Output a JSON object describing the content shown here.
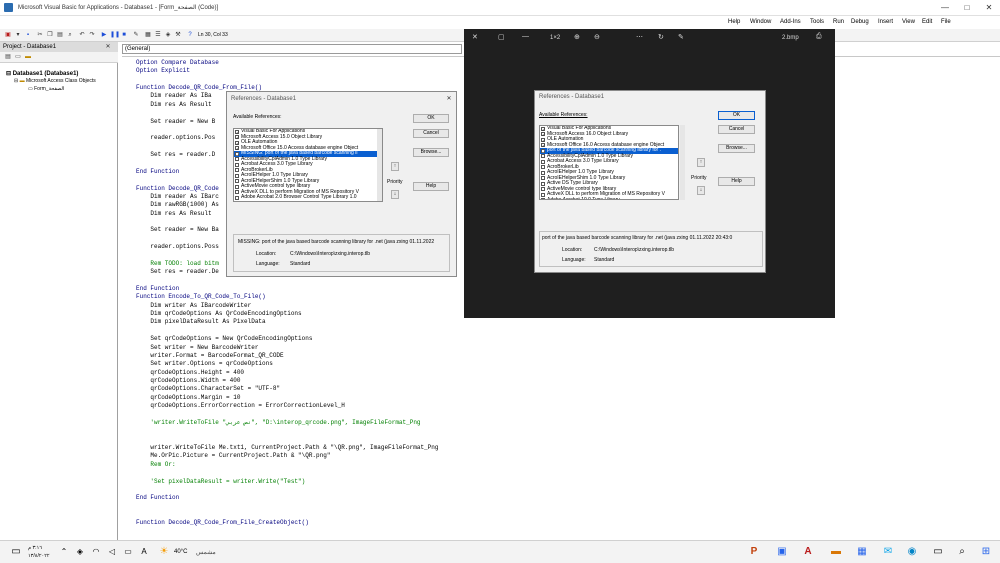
{
  "titlebar": {
    "title": "Microsoft Visual Basic for Applications - Database1 - [Form_الصفحة (Code)]",
    "min": "—",
    "max": "□",
    "close": "✕"
  },
  "menus": [
    "Help",
    "Window",
    "Add-Ins",
    "Tools",
    "Run",
    "Debug",
    "Insert",
    "View",
    "Edit",
    "File"
  ],
  "toolbar": {
    "position": "Ln 30, Col 33"
  },
  "project": {
    "header": "Project - Database1",
    "root": "Database1 (Database1)",
    "folder": "Microsoft Access Class Objects",
    "item": "Form_الصفحة"
  },
  "combo": "(General)",
  "code_lines": [
    {
      "t": "Option Compare Database",
      "c": "kw"
    },
    {
      "t": "Option Explicit",
      "c": "kw"
    },
    {
      "t": "",
      "c": ""
    },
    {
      "t": "Function Decode_QR_Code_From_File()",
      "c": "kw"
    },
    {
      "t": "    Dim reader As IBa",
      "c": ""
    },
    {
      "t": "    Dim res As Result",
      "c": ""
    },
    {
      "t": "",
      "c": ""
    },
    {
      "t": "    Set reader = New B",
      "c": ""
    },
    {
      "t": "",
      "c": ""
    },
    {
      "t": "    reader.options.Pos",
      "c": ""
    },
    {
      "t": "",
      "c": ""
    },
    {
      "t": "    Set res = reader.D",
      "c": ""
    },
    {
      "t": "",
      "c": ""
    },
    {
      "t": "End Function",
      "c": "kw"
    },
    {
      "t": "",
      "c": ""
    },
    {
      "t": "Function Decode_QR_Code",
      "c": "kw"
    },
    {
      "t": "    Dim reader As IBarc",
      "c": ""
    },
    {
      "t": "    Dim rawRGB(1000) As",
      "c": ""
    },
    {
      "t": "    Dim res As Result",
      "c": ""
    },
    {
      "t": "",
      "c": ""
    },
    {
      "t": "    Set reader = New Ba",
      "c": ""
    },
    {
      "t": "",
      "c": ""
    },
    {
      "t": "    reader.options.Poss",
      "c": ""
    },
    {
      "t": "",
      "c": ""
    },
    {
      "t": "    Rem TODO: load bitm",
      "c": "cm"
    },
    {
      "t": "    Set res = reader.De",
      "c": ""
    },
    {
      "t": "",
      "c": ""
    },
    {
      "t": "End Function",
      "c": "kw"
    },
    {
      "t": "Function Encode_To_QR_Code_To_File()",
      "c": "kw"
    },
    {
      "t": "    Dim writer As IBarcodeWriter",
      "c": ""
    },
    {
      "t": "    Dim qrCodeOptions As QrCodeEncodingOptions",
      "c": ""
    },
    {
      "t": "    Dim pixelDataResult As PixelData",
      "c": ""
    },
    {
      "t": "",
      "c": ""
    },
    {
      "t": "    Set qrCodeOptions = New QrCodeEncodingOptions",
      "c": ""
    },
    {
      "t": "    Set writer = New BarcodeWriter",
      "c": ""
    },
    {
      "t": "    writer.Format = BarcodeFormat_QR_CODE",
      "c": ""
    },
    {
      "t": "    Set writer.Options = qrCodeOptions",
      "c": ""
    },
    {
      "t": "    qrCodeOptions.Height = 400",
      "c": ""
    },
    {
      "t": "    qrCodeOptions.Width = 400",
      "c": ""
    },
    {
      "t": "    qrCodeOptions.CharacterSet = \"UTF-8\"",
      "c": ""
    },
    {
      "t": "    qrCodeOptions.Margin = 10",
      "c": ""
    },
    {
      "t": "    qrCodeOptions.ErrorCorrection = ErrorCorrectionLevel_H",
      "c": ""
    },
    {
      "t": "",
      "c": ""
    },
    {
      "t": "    'writer.WriteToFile \"نص عربي\", \"D:\\interop_qrcode.png\", ImageFileFormat_Png",
      "c": "cm"
    },
    {
      "t": "",
      "c": ""
    },
    {
      "t": "",
      "c": ""
    },
    {
      "t": "    writer.WriteToFile Me.txt1, CurrentProject.Path & \"\\QR.png\", ImageFileFormat_Png",
      "c": ""
    },
    {
      "t": "    Me.OrPic.Picture = CurrentProject.Path & \"\\QR.png\"",
      "c": ""
    },
    {
      "t": "    Rem Or:",
      "c": "cm"
    },
    {
      "t": "",
      "c": ""
    },
    {
      "t": "    'Set pixelDataResult = writer.Write(\"Test\")",
      "c": "cm"
    },
    {
      "t": "",
      "c": ""
    },
    {
      "t": "End Function",
      "c": "kw"
    },
    {
      "t": "",
      "c": ""
    },
    {
      "t": "",
      "c": ""
    },
    {
      "t": "Function Decode_QR_Code_From_File_CreateObject()",
      "c": "kw"
    }
  ],
  "dialog1": {
    "title": "References - Database1",
    "available": "Available References:",
    "priority": "Priority",
    "ok": "OK",
    "cancel": "Cancel",
    "browse": "Browse...",
    "help": "Help",
    "items": [
      {
        "label": "Visual Basic For Applications",
        "checked": true,
        "sel": false
      },
      {
        "label": "Microsoft Access 15.0 Object Library",
        "checked": true,
        "sel": false
      },
      {
        "label": "OLE Automation",
        "checked": true,
        "sel": false
      },
      {
        "label": "Microsoft Office 15.0 Access database engine Object",
        "checked": true,
        "sel": false
      },
      {
        "label": "MISSING: port of the java based barcode scanning li",
        "checked": true,
        "sel": true
      },
      {
        "label": "AccessibilityCplAdmin 1.0 Type Library",
        "checked": false,
        "sel": false
      },
      {
        "label": "Acrobat Access 3.0 Type Library",
        "checked": false,
        "sel": false
      },
      {
        "label": "AcroBrokerLib",
        "checked": false,
        "sel": false
      },
      {
        "label": "AcroIEHelper 1.0 Type Library",
        "checked": false,
        "sel": false
      },
      {
        "label": "AcroIEHelperShim 1.0 Type Library",
        "checked": false,
        "sel": false
      },
      {
        "label": "ActiveMovie control type library",
        "checked": false,
        "sel": false
      },
      {
        "label": "ActiveX DLL to perform Migration of MS Repository V",
        "checked": false,
        "sel": false
      },
      {
        "label": "Adobe Acrobat 2.0 Browser Control Type Library 1.0",
        "checked": false,
        "sel": false
      }
    ],
    "missing": "MISSING: port of the java based barcode scanning library for .net (java zxing 01.11.2022",
    "location_label": "Location:",
    "location": "C:\\Windows\\Interop\\zxing.interop.tlb",
    "language_label": "Language:",
    "language": "Standard"
  },
  "viewer": {
    "zoom": "1×2",
    "filename": "2.bmp"
  },
  "dialog2": {
    "title": "References - Database1",
    "available": "Available References:",
    "priority": "Priority",
    "ok": "OK",
    "cancel": "Cancel",
    "browse": "Browse...",
    "help": "Help",
    "items": [
      {
        "label": "Visual Basic For Applications",
        "checked": true,
        "sel": false
      },
      {
        "label": "Microsoft Access 16.0 Object Library",
        "checked": true,
        "sel": false
      },
      {
        "label": "OLE Automation",
        "checked": true,
        "sel": false
      },
      {
        "label": "Microsoft Office 16.0 Access database engine Object",
        "checked": true,
        "sel": false
      },
      {
        "label": "port of the java based barcode scanning library for .",
        "checked": true,
        "sel": true
      },
      {
        "label": "AccessibilityCplAdmin 1.0 Type Library",
        "checked": false,
        "sel": false
      },
      {
        "label": "Acrobat Access 3.0 Type Library",
        "checked": false,
        "sel": false
      },
      {
        "label": "AcroBrokerLib",
        "checked": false,
        "sel": false
      },
      {
        "label": "AcroIEHelper 1.0 Type Library",
        "checked": false,
        "sel": false
      },
      {
        "label": "AcroIEHelperShim 1.0 Type Library",
        "checked": false,
        "sel": false
      },
      {
        "label": "Active DS Type Library",
        "checked": false,
        "sel": false
      },
      {
        "label": "ActiveMovie control type library",
        "checked": false,
        "sel": false
      },
      {
        "label": "ActiveX DLL to perform Migration of MS Repository V",
        "checked": false,
        "sel": false
      },
      {
        "label": "Adobe Acrobat 10.0 Type Library",
        "checked": false,
        "sel": false
      }
    ],
    "desc": "port of the java based barcode scanning library for .net (java zxing 01.11.2022 20:43:0",
    "location_label": "Location:",
    "location": "C:\\Windows\\Interop\\zxing.interop.tlb",
    "language_label": "Language:",
    "language": "Standard"
  },
  "taskbar": {
    "weather": "40°C",
    "weather_text": "مشمس",
    "time": "٣:١٦ م",
    "date": "١٣/٨/٢٠٢٢"
  }
}
